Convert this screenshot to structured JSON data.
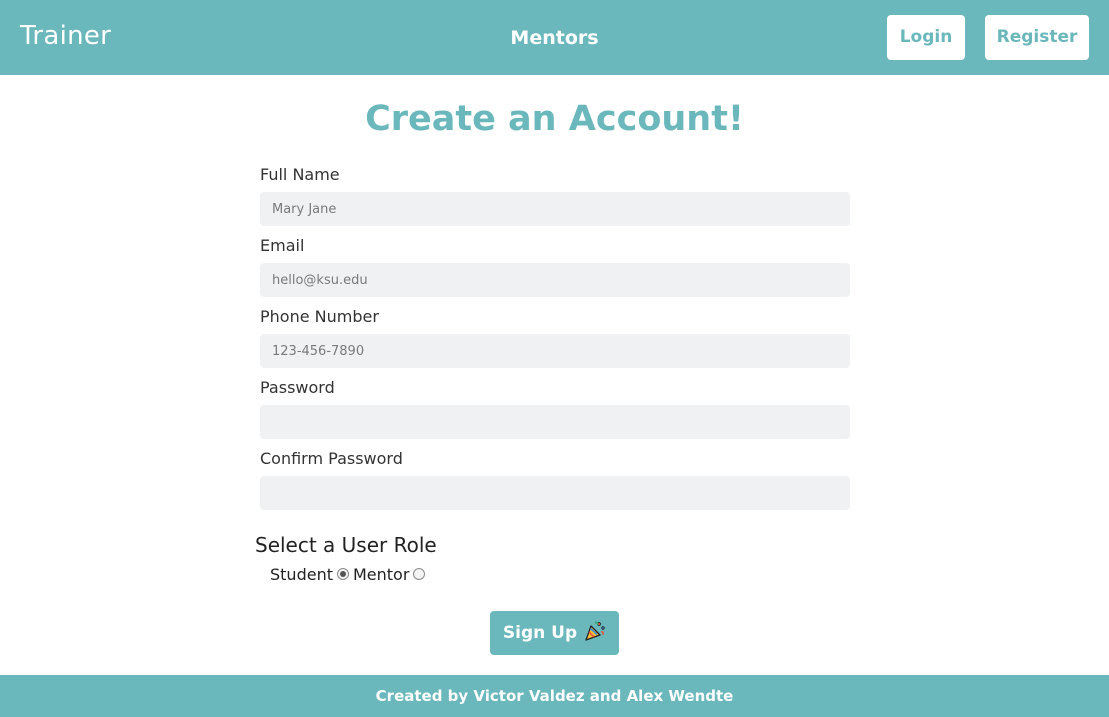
{
  "header": {
    "brand": "Trainer",
    "nav_center": "Mentors",
    "login_label": "Login",
    "register_label": "Register"
  },
  "form": {
    "title": "Create an Account!",
    "fields": [
      {
        "label": "Full Name",
        "placeholder": "Mary Jane",
        "value": ""
      },
      {
        "label": "Email",
        "placeholder": "hello@ksu.edu",
        "value": ""
      },
      {
        "label": "Phone Number",
        "placeholder": "123-456-7890",
        "value": ""
      },
      {
        "label": "Password",
        "placeholder": "",
        "value": ""
      },
      {
        "label": "Confirm Password",
        "placeholder": "",
        "value": ""
      }
    ],
    "role": {
      "title": "Select a User Role",
      "options": [
        {
          "label": "Student",
          "checked": true
        },
        {
          "label": "Mentor",
          "checked": false
        }
      ]
    },
    "submit_label": "Sign Up",
    "submit_icon": "party-popper-icon"
  },
  "footer": {
    "text": "Created by Victor Valdez and Alex Wendte"
  },
  "colors": {
    "accent": "#6ab7bc",
    "input_bg": "#f0f1f3"
  }
}
